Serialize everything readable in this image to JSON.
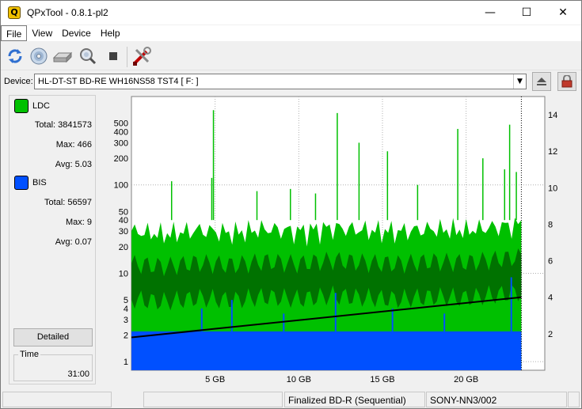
{
  "window": {
    "title": "QPxTool - 0.8.1-pl2",
    "app_icon_glyph": "Q",
    "controls": {
      "minimize": "—",
      "maximize": "☐",
      "close": "✕"
    }
  },
  "menu": [
    "File",
    "View",
    "Device",
    "Help"
  ],
  "toolbar": {
    "icons": [
      "refresh-icon",
      "media-scan-icon",
      "drive-icon",
      "zoom-search-icon",
      "stop-icon",
      "settings-tools-icon"
    ]
  },
  "device": {
    "label": "Device:",
    "value": "HL-DT-ST BD-RE  WH16NS58  TST4 [ F: ]"
  },
  "legend": {
    "ldc": {
      "name": "LDC",
      "color": "#00c000",
      "total_label": "Total:",
      "total": "3841573",
      "max_label": "Max:",
      "max": "466",
      "avg_label": "Avg:",
      "avg": "5.03"
    },
    "bis": {
      "name": "BIS",
      "color": "#0050ff",
      "total_label": "Total:",
      "total": "56597",
      "max_label": "Max:",
      "max": "9",
      "avg_label": "Avg:",
      "avg": "0.07"
    }
  },
  "detailed_button": "Detailed",
  "time": {
    "label": "Time",
    "value": "31:00"
  },
  "status": {
    "cells": [
      "",
      "",
      "Finalized BD-R (Sequential)",
      "SONY-NN3/002",
      ""
    ]
  },
  "chart_data": {
    "type": "area",
    "xlabel": "",
    "ylabel": "",
    "x_unit": "GB",
    "xlim": [
      0,
      24.7
    ],
    "x_ticks": [
      5,
      10,
      15,
      20
    ],
    "x_tick_labels": [
      "5 GB",
      "10 GB",
      "15 GB",
      "20 GB"
    ],
    "left_axis": {
      "scale": "log",
      "ylim": [
        0.8,
        1000
      ],
      "ticks": [
        1,
        2,
        3,
        4,
        5,
        10,
        20,
        30,
        40,
        50,
        100,
        200,
        300,
        400,
        500
      ]
    },
    "right_axis": {
      "scale": "linear",
      "ylim": [
        0,
        15
      ],
      "ticks": [
        2,
        4,
        6,
        8,
        10,
        12,
        14
      ]
    },
    "data_end_gb": 23.3,
    "grid": true,
    "series": [
      {
        "name": "LDC",
        "axis": "left",
        "color": "#00c000",
        "dark_band_color": "#006400",
        "x": [
          0,
          2,
          4,
          6,
          8,
          10,
          12,
          14,
          16,
          18,
          20,
          22,
          23.3
        ],
        "values": [
          30,
          28,
          31,
          29,
          32,
          30,
          33,
          31,
          30,
          32,
          31,
          34,
          36
        ],
        "peaks": [
          {
            "x": 2.4,
            "value": 110
          },
          {
            "x": 4.8,
            "value": 120
          },
          {
            "x": 4.9,
            "value": 700
          },
          {
            "x": 7.5,
            "value": 85
          },
          {
            "x": 9.5,
            "value": 90
          },
          {
            "x": 11.0,
            "value": 80
          },
          {
            "x": 12.3,
            "value": 650
          },
          {
            "x": 13.6,
            "value": 300
          },
          {
            "x": 15.3,
            "value": 240
          },
          {
            "x": 17.1,
            "value": 100
          },
          {
            "x": 19.5,
            "value": 430
          },
          {
            "x": 21.0,
            "value": 200
          },
          {
            "x": 22.3,
            "value": 150
          },
          {
            "x": 22.6,
            "value": 480
          },
          {
            "x": 23.0,
            "value": 140
          }
        ]
      },
      {
        "name": "BIS",
        "axis": "left",
        "color": "#0050ff",
        "x": [
          0,
          23.3
        ],
        "values": [
          2.2,
          2.2
        ],
        "spikes": [
          {
            "x": 4.2,
            "value": 4
          },
          {
            "x": 6.0,
            "value": 5
          },
          {
            "x": 9.1,
            "value": 3.5
          },
          {
            "x": 12.2,
            "value": 6
          },
          {
            "x": 15.6,
            "value": 4
          },
          {
            "x": 18.7,
            "value": 3.5
          },
          {
            "x": 22.7,
            "value": 9
          }
        ]
      },
      {
        "name": "Speed",
        "axis": "right",
        "color": "#000000",
        "x": [
          0,
          23.3
        ],
        "values": [
          1.8,
          4.0
        ]
      }
    ]
  }
}
